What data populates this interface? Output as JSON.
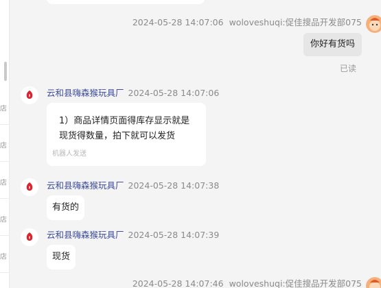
{
  "left_list": {
    "fragments": [
      "店",
      "店",
      "店",
      "店",
      "店"
    ]
  },
  "messages": [
    {
      "timestamp": "2024-05-28 14:07:06",
      "sender": "woloveshuqi:促佳搜品开发部075",
      "text": "你好有货吗",
      "status": "已读"
    },
    {
      "shop": "云和县嗨森猴玩具厂",
      "timestamp": "2024-05-28 14:07:06",
      "text": "1）商品详情页面得库存显示就是现货得数量，拍下就可以发货",
      "line1": "1）商品详情页面得库存显示就是",
      "line2": "现货得数量，拍下就可以发货",
      "note": "机器人发送"
    },
    {
      "shop": "云和县嗨森猴玩具厂",
      "timestamp": "2024-05-28 14:07:38",
      "text": "有货的"
    },
    {
      "shop": "云和县嗨森猴玩具厂",
      "timestamp": "2024-05-28 14:07:39",
      "text": "现货"
    },
    {
      "timestamp": "2024-05-28 14:07:46",
      "sender": "woloveshuqi:促佳搜品开发部075"
    }
  ],
  "colors": {
    "background": "#f4f4f4",
    "shop_name": "#3d4c9e",
    "own_bubble": "#e6e6e6",
    "shop_logo": "#d9232d"
  },
  "icons": {
    "own_avatar": "orange-cartoon-avatar-icon",
    "shop_avatar": "shop-logo-icon"
  }
}
